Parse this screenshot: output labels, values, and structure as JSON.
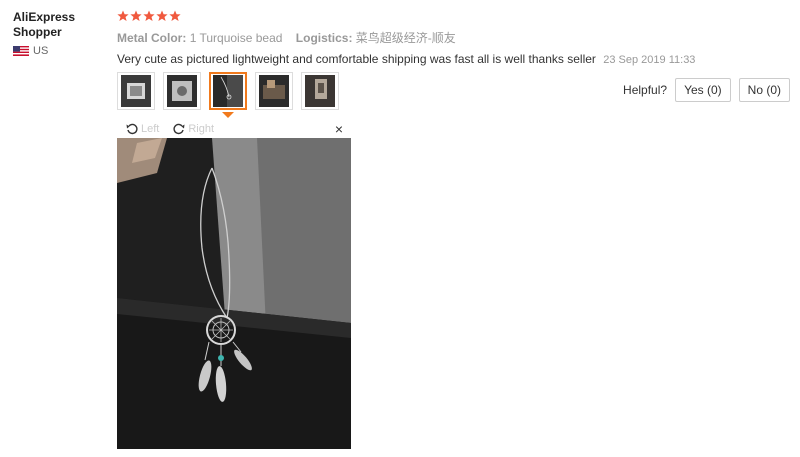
{
  "user": {
    "name": "AliExpress Shopper",
    "country": "US"
  },
  "review": {
    "rating": 5,
    "attributes": [
      {
        "label": "Metal Color:",
        "value": "1 Turquoise bead"
      },
      {
        "label": "Logistics:",
        "value": "菜鸟超级经济-顺友"
      }
    ],
    "text": "Very cute as pictured lightweight and comfortable shipping was fast all is well thanks seller",
    "date": "23 Sep 2019 11:33"
  },
  "thumbnails": {
    "count": 5,
    "active_index": 2
  },
  "helpful": {
    "label": "Helpful?",
    "yes_label": "Yes (0)",
    "no_label": "No (0)"
  },
  "viewer": {
    "rotate_left_label": "Left",
    "rotate_right_label": "Right",
    "close_symbol": "×"
  },
  "colors": {
    "star": "#f0593e",
    "active_thumb_border": "#f17a1d"
  }
}
